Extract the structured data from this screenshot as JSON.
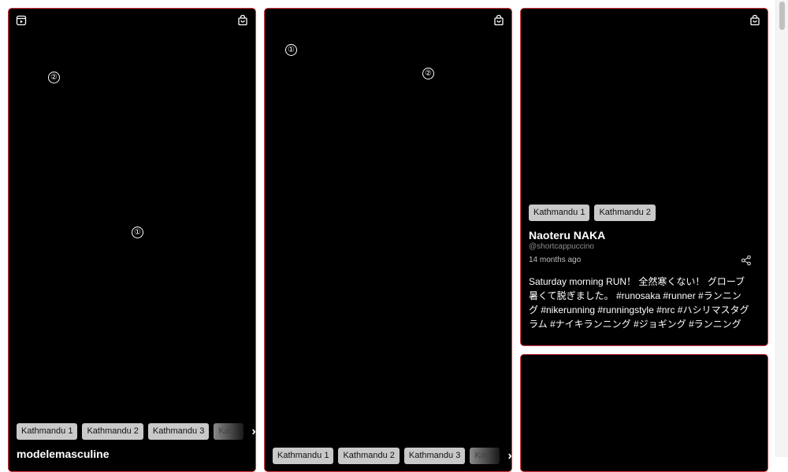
{
  "cards": [
    {
      "tags": [
        "Kathmandu 1",
        "Kathmandu 2",
        "Kathmandu 3",
        "Kat"
      ],
      "username": "modelemasculine",
      "markers": [
        "②",
        "①"
      ],
      "icons": {
        "top_left": "play-square-icon",
        "top_right": "shopping-bag-icon"
      }
    },
    {
      "tags": [
        "Kathmandu 1",
        "Kathmandu 2",
        "Kathmandu 3",
        "Kat"
      ],
      "markers": [
        "①",
        "②"
      ],
      "icons": {
        "top_right": "shopping-bag-icon"
      }
    },
    {
      "tags": [
        "Kathmandu 1",
        "Kathmandu 2"
      ],
      "username": "Naoteru NAKA",
      "handle": "@shortcappuccino",
      "age": "14 months ago",
      "caption": "Saturday morning RUN！ 全然寒くない！ グローブ暑くて脱ぎました。 #runosaka #runner #ランニング #nikerunning #runningstyle #nrc #ハシリマスタグラム #ナイキランニング #ジョギング #ランニング",
      "icons": {
        "top_right": "shopping-bag-icon",
        "share": "share-icon"
      }
    },
    {}
  ]
}
